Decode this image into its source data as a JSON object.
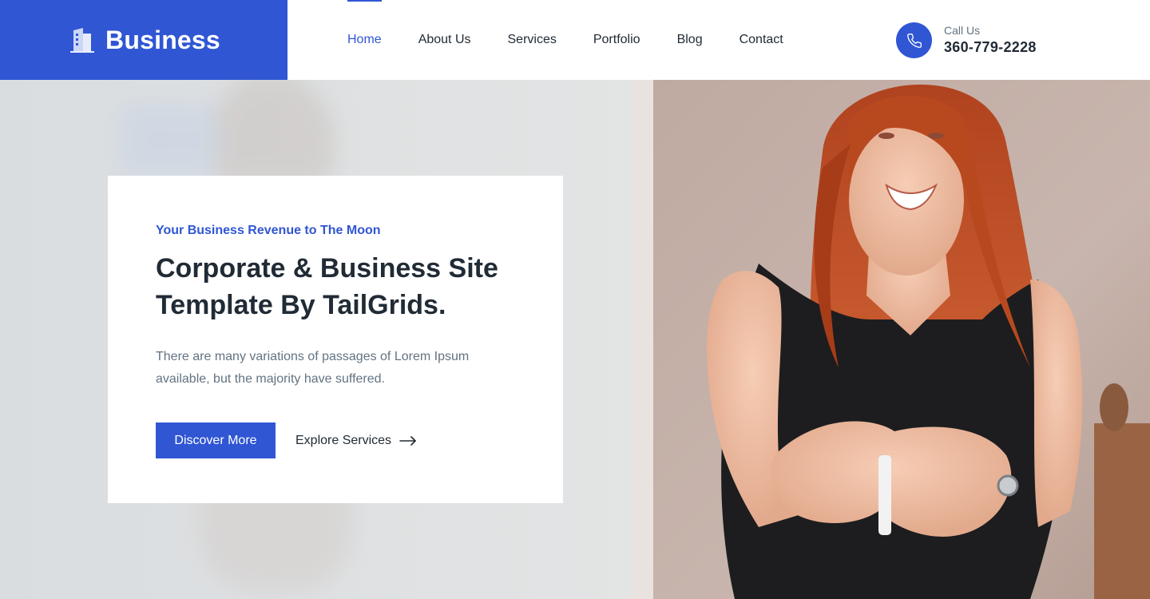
{
  "brand": {
    "name": "Business",
    "icon": "building-icon"
  },
  "nav": {
    "items": [
      {
        "label": "Home",
        "active": true
      },
      {
        "label": "About Us",
        "active": false
      },
      {
        "label": "Services",
        "active": false
      },
      {
        "label": "Portfolio",
        "active": false
      },
      {
        "label": "Blog",
        "active": false
      },
      {
        "label": "Contact",
        "active": false
      }
    ]
  },
  "call": {
    "label": "Call Us",
    "number": "360-779-2228",
    "icon": "phone-icon"
  },
  "hero": {
    "kicker": "Your Business Revenue to The Moon",
    "title_line1": "Corporate & Business Site",
    "title_line2": "Template By TailGrids.",
    "description": "There are many variations of passages of Lorem Ipsum available, but the majority have suffered.",
    "primary_button": "Discover More",
    "secondary_link": "Explore Services",
    "secondary_icon": "arrow-right-icon"
  },
  "colors": {
    "accent": "#3056D3",
    "heading": "#212B36",
    "body": "#637381"
  }
}
